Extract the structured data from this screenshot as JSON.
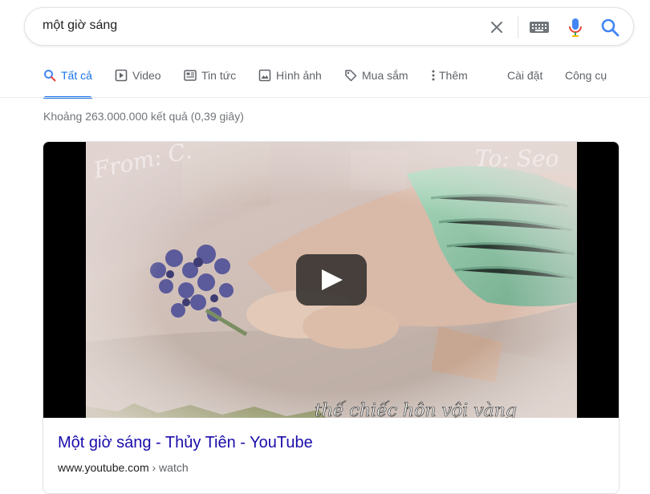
{
  "search": {
    "query": "một giờ sáng"
  },
  "tabs": [
    {
      "label": "Tất cả",
      "icon": "search-icon",
      "active": true
    },
    {
      "label": "Video",
      "icon": "video-icon"
    },
    {
      "label": "Tin tức",
      "icon": "news-icon"
    },
    {
      "label": "Hình ảnh",
      "icon": "image-icon"
    },
    {
      "label": "Mua sắm",
      "icon": "tag-icon"
    },
    {
      "label": "Thêm",
      "icon": "more-vert-icon"
    }
  ],
  "tools": {
    "settings_label": "Cài đặt",
    "tools_label": "Công cụ"
  },
  "result_stats": "Khoảng 263.000.000 kết quả (0,39 giây)",
  "video_result": {
    "thumbnail_text_from": "From: C.",
    "thumbnail_text_to": "To: Seo",
    "caption": "thế chiếc hôn vội vàng",
    "title": "Một giờ sáng - Thủy Tiên - YouTube",
    "url_domain": "www.youtube.com",
    "url_path": " › watch"
  },
  "colors": {
    "link": "#1a0dab",
    "accent": "#1a73e8",
    "muted": "#70757a"
  }
}
